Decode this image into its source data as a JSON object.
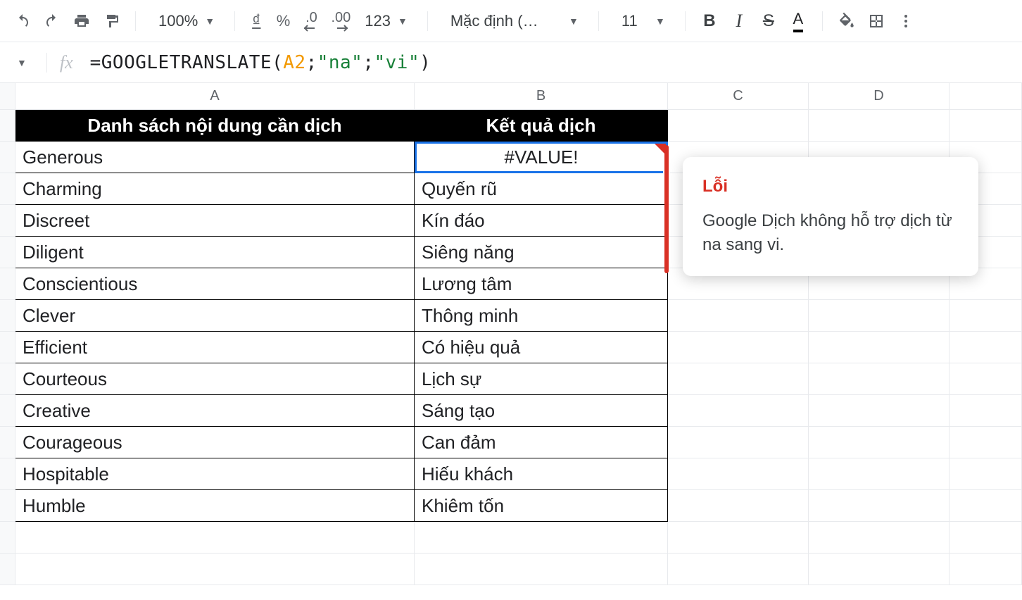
{
  "toolbar": {
    "zoom": "100%",
    "currency": "₫",
    "percent": "%",
    "dec_dec": ".0",
    "inc_dec": ".00",
    "num_fmt": "123",
    "font": "Mặc định (…",
    "font_size": "11",
    "text_color_glyph": "A"
  },
  "formula_bar": {
    "fn_name": "GOOGLETRANSLATE",
    "cell_ref": "A2",
    "arg1": "\"na\"",
    "arg2": "\"vi\""
  },
  "columns": [
    "A",
    "B",
    "C",
    "D"
  ],
  "headers": {
    "col_a": "Danh sách nội dung cần dịch",
    "col_b": "Kết quả dịch"
  },
  "rows": [
    {
      "a": "Generous",
      "b": "#VALUE!"
    },
    {
      "a": "Charming",
      "b": "Quyến rũ"
    },
    {
      "a": "Discreet",
      "b": "Kín đáo"
    },
    {
      "a": "Diligent",
      "b": "Siêng năng"
    },
    {
      "a": "Conscientious",
      "b": "Lương tâm"
    },
    {
      "a": "Clever",
      "b": "Thông minh"
    },
    {
      "a": "Efficient",
      "b": "Có hiệu quả"
    },
    {
      "a": "Courteous",
      "b": "Lịch sự"
    },
    {
      "a": "Creative",
      "b": "Sáng tạo"
    },
    {
      "a": "Courageous",
      "b": "Can đảm"
    },
    {
      "a": "Hospitable",
      "b": "Hiếu khách"
    },
    {
      "a": "Humble",
      "b": "Khiêm tốn"
    }
  ],
  "error_tooltip": {
    "title": "Lỗi",
    "body": "Google Dịch không hỗ trợ dịch từ na sang vi."
  }
}
